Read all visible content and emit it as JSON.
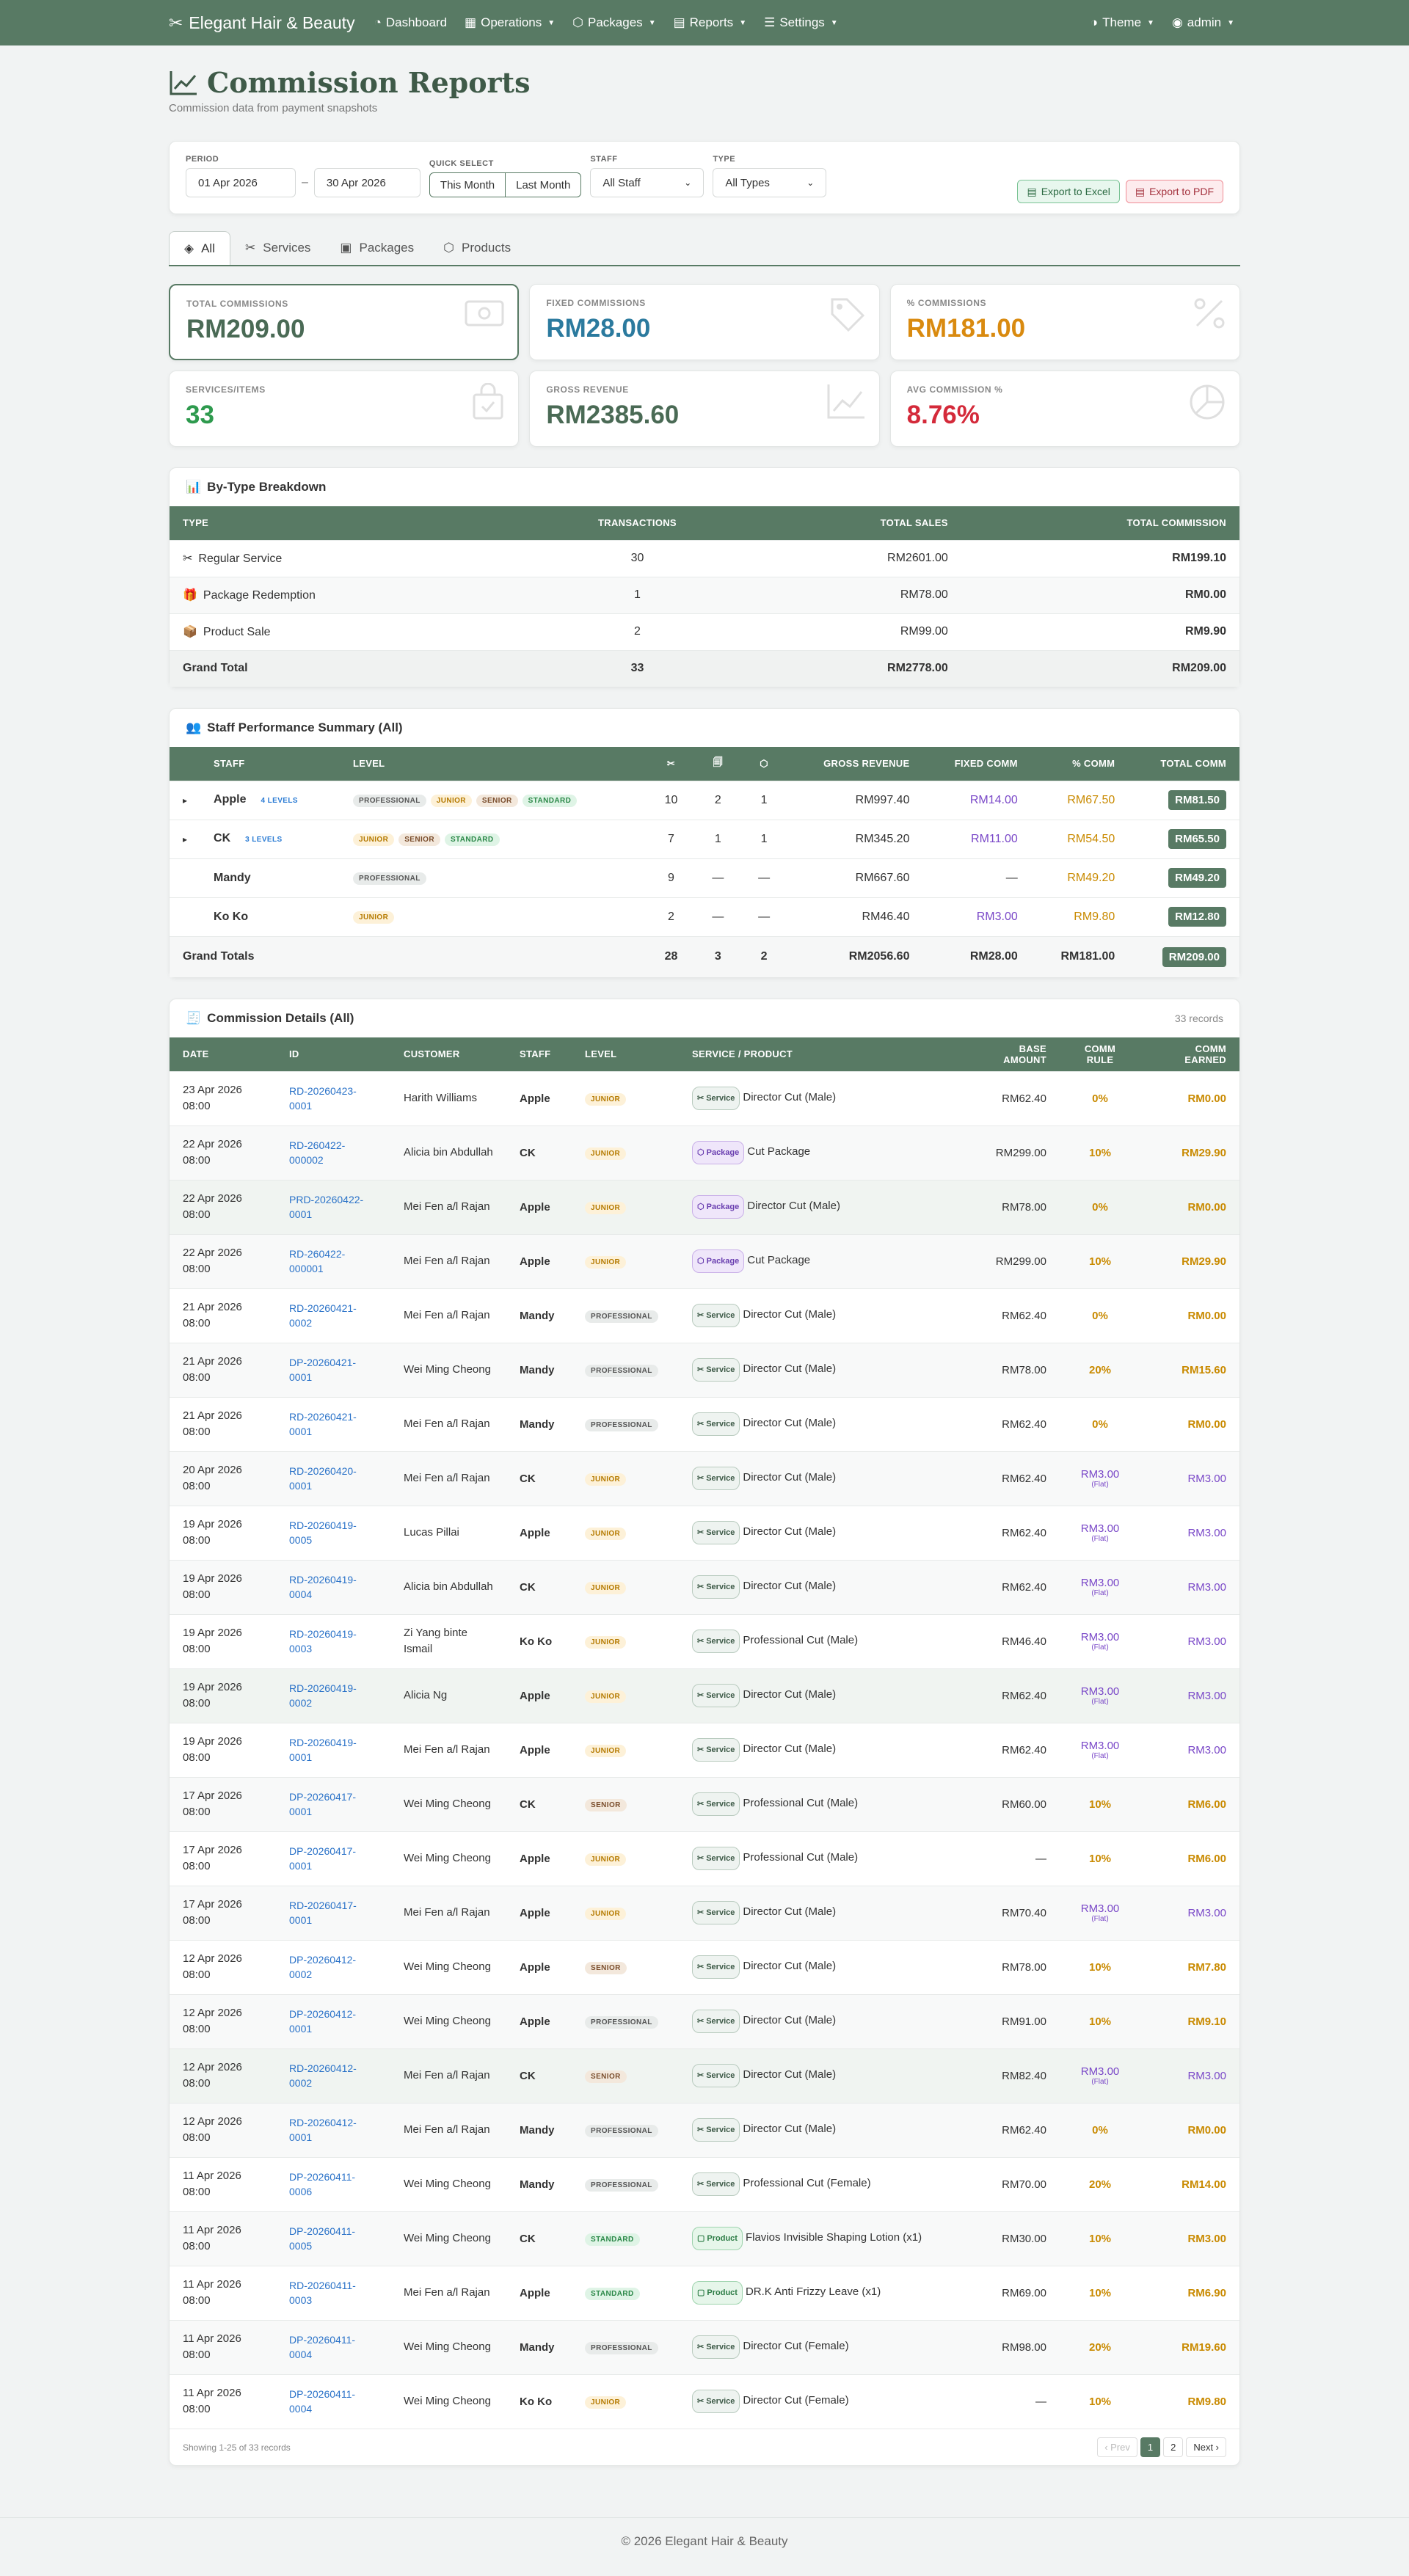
{
  "nav": {
    "brand": "Elegant Hair & Beauty",
    "items": [
      "Dashboard",
      "Operations",
      "Packages",
      "Reports",
      "Settings"
    ],
    "theme": "Theme",
    "user": "admin"
  },
  "page": {
    "title": "Commission Reports",
    "subtitle": "Commission data from payment snapshots"
  },
  "filters": {
    "period_label": "PERIOD",
    "from": "01 Apr 2026",
    "to": "30 Apr 2026",
    "quick_label": "QUICK SELECT",
    "this_month": "This Month",
    "last_month": "Last Month",
    "staff_label": "STAFF",
    "staff_value": "All Staff",
    "type_label": "TYPE",
    "type_value": "All Types",
    "export_excel": "Export to Excel",
    "export_pdf": "Export to PDF"
  },
  "tabs": [
    "All",
    "Services",
    "Packages",
    "Products"
  ],
  "stats": [
    {
      "label": "TOTAL COMMISSIONS",
      "value": "RM209.00",
      "color": "#4a6a55"
    },
    {
      "label": "FIXED COMMISSIONS",
      "value": "RM28.00",
      "color": "#2b7a9e"
    },
    {
      "label": "% COMMISSIONS",
      "value": "RM181.00",
      "color": "#d98a0f"
    },
    {
      "label": "SERVICES/ITEMS",
      "value": "33",
      "color": "#2e9a4e"
    },
    {
      "label": "GROSS REVENUE",
      "value": "RM2385.60",
      "color": "#4a6a55"
    },
    {
      "label": "AVG COMMISSION %",
      "value": "8.76%",
      "color": "#d42a3a"
    }
  ],
  "breakdown": {
    "title": "By-Type Breakdown",
    "headers": [
      "TYPE",
      "TRANSACTIONS",
      "TOTAL SALES",
      "TOTAL COMMISSION"
    ],
    "rows": [
      [
        "✂",
        "Regular Service",
        "30",
        "RM2601.00",
        "RM199.10"
      ],
      [
        "🎁",
        "Package Redemption",
        "1",
        "RM78.00",
        "RM0.00"
      ],
      [
        "📦",
        "Product Sale",
        "2",
        "RM99.00",
        "RM9.90"
      ]
    ],
    "total": [
      "Grand Total",
      "33",
      "RM2778.00",
      "RM209.00"
    ]
  },
  "staff": {
    "title": "Staff Performance Summary (All)",
    "headers": [
      "STAFF",
      "LEVEL",
      "✂",
      "🗐",
      "⬡",
      "GROSS REVENUE",
      "FIXED COMM",
      "% COMM",
      "TOTAL COMM"
    ],
    "rows": [
      {
        "exp": "▸",
        "name": "Apple",
        "lvlcount": "4 LEVELS",
        "levels": [
          "PROFESSIONAL",
          "JUNIOR",
          "SENIOR",
          "STANDARD"
        ],
        "s": "10",
        "p": "2",
        "pr": "1",
        "gross": "RM997.40",
        "fixed": "RM14.00",
        "pct": "RM67.50",
        "total": "RM81.50"
      },
      {
        "exp": "▸",
        "name": "CK",
        "lvlcount": "3 LEVELS",
        "levels": [
          "JUNIOR",
          "SENIOR",
          "STANDARD"
        ],
        "s": "7",
        "p": "1",
        "pr": "1",
        "gross": "RM345.20",
        "fixed": "RM11.00",
        "pct": "RM54.50",
        "total": "RM65.50"
      },
      {
        "exp": "",
        "name": "Mandy",
        "lvlcount": "",
        "levels": [
          "PROFESSIONAL"
        ],
        "s": "9",
        "p": "—",
        "pr": "—",
        "gross": "RM667.60",
        "fixed": "—",
        "pct": "RM49.20",
        "total": "RM49.20"
      },
      {
        "exp": "",
        "name": "Ko Ko",
        "lvlcount": "",
        "levels": [
          "JUNIOR"
        ],
        "s": "2",
        "p": "—",
        "pr": "—",
        "gross": "RM46.40",
        "fixed": "RM3.00",
        "pct": "RM9.80",
        "total": "RM12.80"
      }
    ],
    "total": {
      "label": "Grand Totals",
      "s": "28",
      "p": "3",
      "pr": "2",
      "gross": "RM2056.60",
      "fixed": "RM28.00",
      "pct": "RM181.00",
      "total": "RM209.00"
    }
  },
  "details": {
    "title": "Commission Details (All)",
    "count": "33 records",
    "headers": [
      "DATE",
      "ID",
      "CUSTOMER",
      "STAFF",
      "LEVEL",
      "SERVICE / PRODUCT",
      "BASE AMOUNT",
      "COMM RULE",
      "COMM EARNED"
    ],
    "rows": [
      [
        "23 Apr 2026 08:00",
        "RD-20260423-0001",
        "Harith Williams",
        "Apple",
        "JUNIOR",
        "Service",
        "Director Cut (Male)",
        "RM62.40",
        "0%",
        "",
        "RM0.00"
      ],
      [
        "22 Apr 2026 08:00",
        "RD-260422-000002",
        "Alicia bin Abdullah",
        "CK",
        "JUNIOR",
        "Package",
        "Cut Package",
        "RM299.00",
        "10%",
        "",
        "RM29.90"
      ],
      [
        "22 Apr 2026 08:00",
        "PRD-20260422-0001",
        "Mei Fen a/l Rajan",
        "Apple",
        "JUNIOR",
        "Package",
        "Director Cut (Male)",
        "RM78.00",
        "0%",
        "",
        "RM0.00"
      ],
      [
        "22 Apr 2026 08:00",
        "RD-260422-000001",
        "Mei Fen a/l Rajan",
        "Apple",
        "JUNIOR",
        "Package",
        "Cut Package",
        "RM299.00",
        "10%",
        "",
        "RM29.90"
      ],
      [
        "21 Apr 2026 08:00",
        "RD-20260421-0002",
        "Mei Fen a/l Rajan",
        "Mandy",
        "PROFESSIONAL",
        "Service",
        "Director Cut (Male)",
        "RM62.40",
        "0%",
        "",
        "RM0.00"
      ],
      [
        "21 Apr 2026 08:00",
        "DP-20260421-0001",
        "Wei Ming Cheong",
        "Mandy",
        "PROFESSIONAL",
        "Service",
        "Director Cut (Male)",
        "RM78.00",
        "20%",
        "",
        "RM15.60"
      ],
      [
        "21 Apr 2026 08:00",
        "RD-20260421-0001",
        "Mei Fen a/l Rajan",
        "Mandy",
        "PROFESSIONAL",
        "Service",
        "Director Cut (Male)",
        "RM62.40",
        "0%",
        "",
        "RM0.00"
      ],
      [
        "20 Apr 2026 08:00",
        "RD-20260420-0001",
        "Mei Fen a/l Rajan",
        "CK",
        "JUNIOR",
        "Service",
        "Director Cut (Male)",
        "RM62.40",
        "RM3.00",
        "(Flat)",
        "RM3.00"
      ],
      [
        "19 Apr 2026 08:00",
        "RD-20260419-0005",
        "Lucas Pillai",
        "Apple",
        "JUNIOR",
        "Service",
        "Director Cut (Male)",
        "RM62.40",
        "RM3.00",
        "(Flat)",
        "RM3.00"
      ],
      [
        "19 Apr 2026 08:00",
        "RD-20260419-0004",
        "Alicia bin Abdullah",
        "CK",
        "JUNIOR",
        "Service",
        "Director Cut (Male)",
        "RM62.40",
        "RM3.00",
        "(Flat)",
        "RM3.00"
      ],
      [
        "19 Apr 2026 08:00",
        "RD-20260419-0003",
        "Zi Yang binte Ismail",
        "Ko Ko",
        "JUNIOR",
        "Service",
        "Professional Cut (Male)",
        "RM46.40",
        "RM3.00",
        "(Flat)",
        "RM3.00"
      ],
      [
        "19 Apr 2026 08:00",
        "RD-20260419-0002",
        "Alicia Ng",
        "Apple",
        "JUNIOR",
        "Service",
        "Director Cut (Male)",
        "RM62.40",
        "RM3.00",
        "(Flat)",
        "RM3.00"
      ],
      [
        "19 Apr 2026 08:00",
        "RD-20260419-0001",
        "Mei Fen a/l Rajan",
        "Apple",
        "JUNIOR",
        "Service",
        "Director Cut (Male)",
        "RM62.40",
        "RM3.00",
        "(Flat)",
        "RM3.00"
      ],
      [
        "17 Apr 2026 08:00",
        "DP-20260417-0001",
        "Wei Ming Cheong",
        "CK",
        "SENIOR",
        "Service",
        "Professional Cut (Male)",
        "RM60.00",
        "10%",
        "",
        "RM6.00"
      ],
      [
        "17 Apr 2026 08:00",
        "DP-20260417-0001",
        "Wei Ming Cheong",
        "Apple",
        "JUNIOR",
        "Service",
        "Professional Cut (Male)",
        "—",
        "10%",
        "",
        "RM6.00"
      ],
      [
        "17 Apr 2026 08:00",
        "RD-20260417-0001",
        "Mei Fen a/l Rajan",
        "Apple",
        "JUNIOR",
        "Service",
        "Director Cut (Male)",
        "RM70.40",
        "RM3.00",
        "(Flat)",
        "RM3.00"
      ],
      [
        "12 Apr 2026 08:00",
        "DP-20260412-0002",
        "Wei Ming Cheong",
        "Apple",
        "SENIOR",
        "Service",
        "Director Cut (Male)",
        "RM78.00",
        "10%",
        "",
        "RM7.80"
      ],
      [
        "12 Apr 2026 08:00",
        "DP-20260412-0001",
        "Wei Ming Cheong",
        "Apple",
        "PROFESSIONAL",
        "Service",
        "Director Cut (Male)",
        "RM91.00",
        "10%",
        "",
        "RM9.10"
      ],
      [
        "12 Apr 2026 08:00",
        "RD-20260412-0002",
        "Mei Fen a/l Rajan",
        "CK",
        "SENIOR",
        "Service",
        "Director Cut (Male)",
        "RM82.40",
        "RM3.00",
        "(Flat)",
        "RM3.00"
      ],
      [
        "12 Apr 2026 08:00",
        "RD-20260412-0001",
        "Mei Fen a/l Rajan",
        "Mandy",
        "PROFESSIONAL",
        "Service",
        "Director Cut (Male)",
        "RM62.40",
        "0%",
        "",
        "RM0.00"
      ],
      [
        "11 Apr 2026 08:00",
        "DP-20260411-0006",
        "Wei Ming Cheong",
        "Mandy",
        "PROFESSIONAL",
        "Service",
        "Professional Cut (Female)",
        "RM70.00",
        "20%",
        "",
        "RM14.00"
      ],
      [
        "11 Apr 2026 08:00",
        "DP-20260411-0005",
        "Wei Ming Cheong",
        "CK",
        "STANDARD",
        "Product",
        "Flavios Invisible Shaping Lotion (x1)",
        "RM30.00",
        "10%",
        "",
        "RM3.00"
      ],
      [
        "11 Apr 2026 08:00",
        "RD-20260411-0003",
        "Mei Fen a/l Rajan",
        "Apple",
        "STANDARD",
        "Product",
        "DR.K Anti Frizzy Leave (x1)",
        "RM69.00",
        "10%",
        "",
        "RM6.90"
      ],
      [
        "11 Apr 2026 08:00",
        "DP-20260411-0004",
        "Wei Ming Cheong",
        "Mandy",
        "PROFESSIONAL",
        "Service",
        "Director Cut (Female)",
        "RM98.00",
        "20%",
        "",
        "RM19.60"
      ],
      [
        "11 Apr 2026 08:00",
        "DP-20260411-0004",
        "Wei Ming Cheong",
        "Ko Ko",
        "JUNIOR",
        "Service",
        "Director Cut (Female)",
        "—",
        "10%",
        "",
        "RM9.80"
      ]
    ],
    "showing": "Showing 1-25 of 33 records",
    "pager": [
      "‹ Prev",
      "1",
      "2",
      "Next ›"
    ]
  },
  "footer": "© 2026 Elegant Hair & Beauty"
}
